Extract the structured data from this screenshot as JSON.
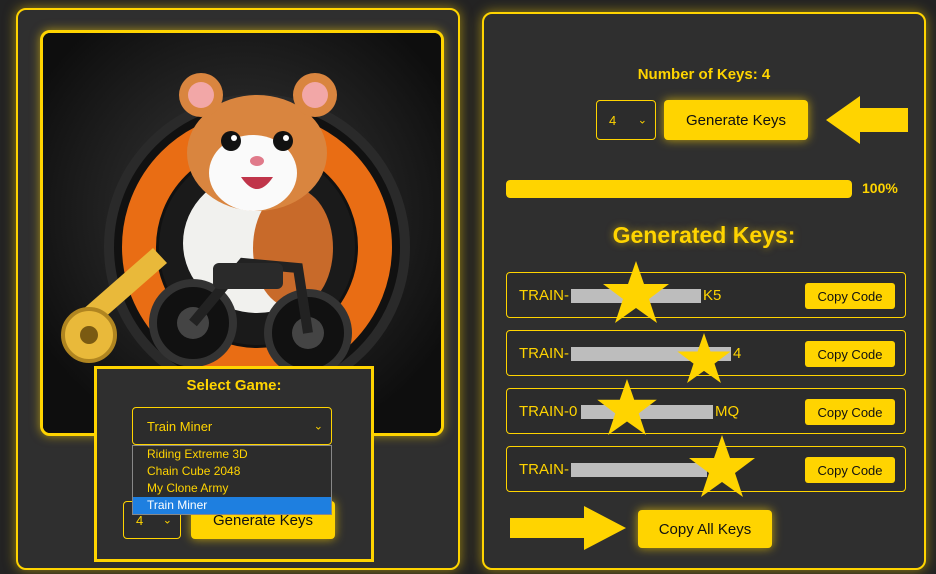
{
  "left": {
    "select_label": "Select Game:",
    "selected_game": "Train Miner",
    "dropdown_options": [
      "Riding Extreme 3D",
      "Chain Cube 2048",
      "My Clone Army",
      "Train Miner"
    ],
    "key_count": "4",
    "generate_label": "Generate Keys"
  },
  "right": {
    "num_keys_label": "Number of Keys: 4",
    "key_count": "4",
    "generate_label": "Generate Keys",
    "progress": {
      "value": 1.0,
      "label": "100%"
    },
    "generated_title": "Generated Keys:",
    "keys": [
      {
        "visible_text": "TRAIN-",
        "suffix": "K5",
        "copy_label": "Copy Code"
      },
      {
        "visible_text": "TRAIN-",
        "suffix": "4",
        "copy_label": "Copy Code"
      },
      {
        "visible_text": "TRAIN-0",
        "suffix": "MQ",
        "copy_label": "Copy Code"
      },
      {
        "visible_text": "TRAIN-",
        "suffix": "",
        "copy_label": "Copy Code"
      }
    ],
    "copy_all_label": "Copy All Keys"
  },
  "colors": {
    "accent": "#ffd400",
    "background": "#232323",
    "panel": "#2f2f2f",
    "selected_option": "#1e7fe0"
  },
  "icons": {
    "arrow": "arrow-icon",
    "star": "star-icon"
  }
}
